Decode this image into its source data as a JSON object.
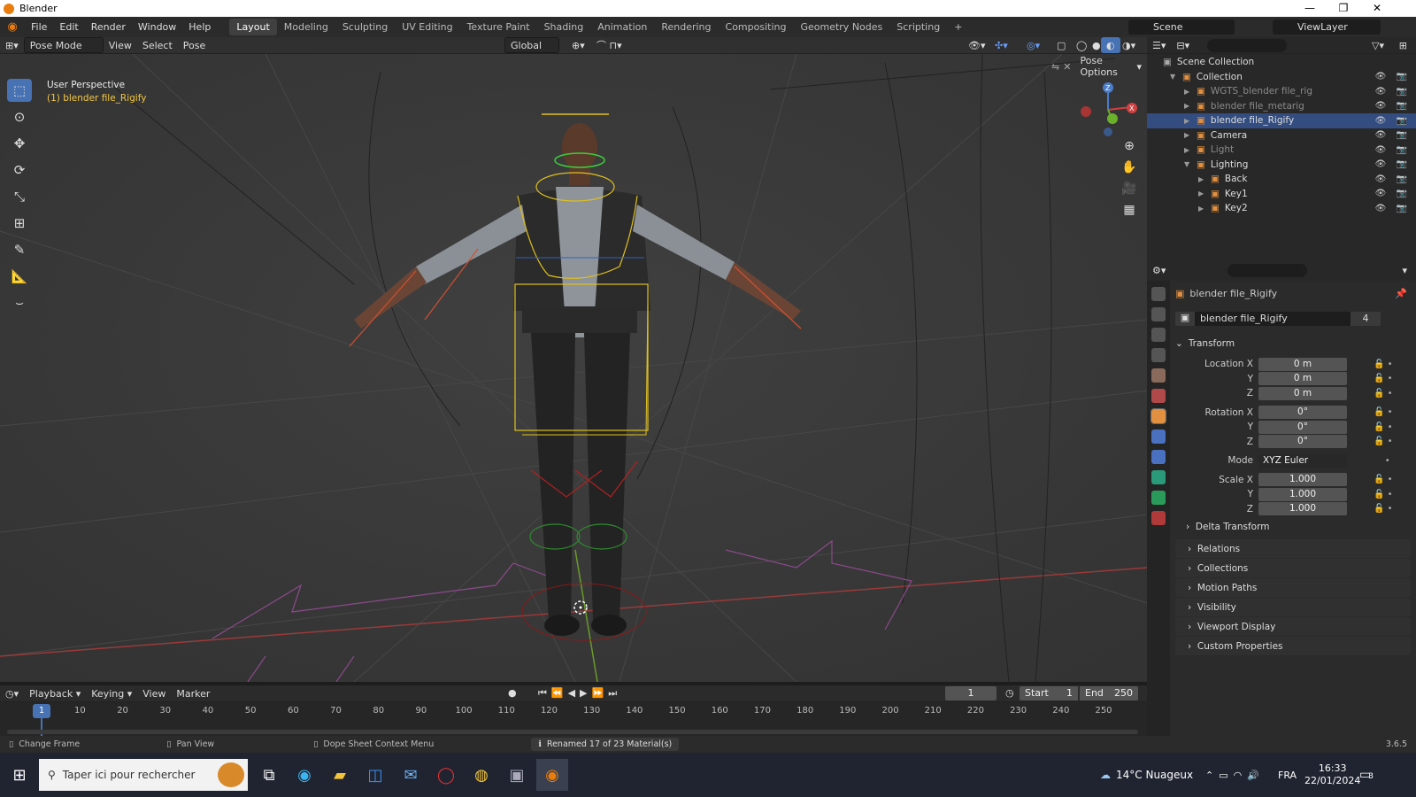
{
  "window": {
    "title": "Blender",
    "minimize": "—",
    "maximize": "❐",
    "close": "✕"
  },
  "menu": [
    "File",
    "Edit",
    "Render",
    "Window",
    "Help"
  ],
  "workspaces": [
    "Layout",
    "Modeling",
    "Sculpting",
    "UV Editing",
    "Texture Paint",
    "Shading",
    "Animation",
    "Rendering",
    "Compositing",
    "Geometry Nodes",
    "Scripting"
  ],
  "active_workspace": "Layout",
  "add_workspace": "+",
  "scene": {
    "label": "Scene",
    "viewlayer": "ViewLayer"
  },
  "viewport_header": {
    "mode": "Pose Mode",
    "menus": [
      "View",
      "Select",
      "Pose"
    ],
    "transform_orientation": "Global",
    "pose_options": "Pose Options"
  },
  "viewport": {
    "perspective": "User Perspective",
    "object_info": "(1) blender file_Rigify",
    "gizmo": {
      "x": "X",
      "y": "Y",
      "z": "Z"
    }
  },
  "outliner": {
    "root": "Scene Collection",
    "items": [
      {
        "label": "Collection",
        "indent": 1,
        "expanded": true,
        "selected": false,
        "dim": false
      },
      {
        "label": "WGTS_blender file_rig",
        "indent": 2,
        "expanded": false,
        "selected": false,
        "dim": true
      },
      {
        "label": "blender file_metarig",
        "indent": 2,
        "expanded": false,
        "selected": false,
        "dim": true
      },
      {
        "label": "blender file_Rigify",
        "indent": 2,
        "expanded": false,
        "selected": true,
        "dim": false
      },
      {
        "label": "Camera",
        "indent": 2,
        "expanded": false,
        "selected": false,
        "dim": false
      },
      {
        "label": "Light",
        "indent": 2,
        "expanded": false,
        "selected": false,
        "dim": true
      },
      {
        "label": "Lighting",
        "indent": 2,
        "expanded": true,
        "selected": false,
        "dim": false
      },
      {
        "label": "Back",
        "indent": 3,
        "expanded": false,
        "selected": false,
        "dim": false
      },
      {
        "label": "Key1",
        "indent": 3,
        "expanded": false,
        "selected": false,
        "dim": false
      },
      {
        "label": "Key2",
        "indent": 3,
        "expanded": false,
        "selected": false,
        "dim": false
      }
    ]
  },
  "properties": {
    "object_name": "blender file_Rigify",
    "data_name": "blender file_Rigify",
    "users": "4",
    "transform_title": "Transform",
    "location": {
      "label": "Location X",
      "x": "0 m",
      "y": "0 m",
      "z": "0 m"
    },
    "rotation": {
      "label": "Rotation X",
      "x": "0°",
      "y": "0°",
      "z": "0°"
    },
    "mode": {
      "label": "Mode",
      "value": "XYZ Euler"
    },
    "scale": {
      "label": "Scale X",
      "x": "1.000",
      "y": "1.000",
      "z": "1.000"
    },
    "axis_y": "Y",
    "axis_z": "Z",
    "delta_transform": "Delta Transform",
    "panels": [
      "Relations",
      "Collections",
      "Motion Paths",
      "Visibility",
      "Viewport Display",
      "Custom Properties"
    ]
  },
  "timeline": {
    "menus": [
      "Playback",
      "Keying",
      "View",
      "Marker"
    ],
    "current_frame": "1",
    "start_label": "Start",
    "start": "1",
    "end_label": "End",
    "end": "250",
    "ticks": [
      1,
      10,
      20,
      30,
      40,
      50,
      60,
      70,
      80,
      90,
      100,
      110,
      120,
      130,
      140,
      150,
      160,
      170,
      180,
      190,
      200,
      210,
      220,
      230,
      240,
      250
    ]
  },
  "statusbar": {
    "change_frame": "Change Frame",
    "pan_view": "Pan View",
    "context_menu": "Dope Sheet Context Menu",
    "message": "Renamed 17 of 23 Material(s)",
    "version": "3.6.5"
  },
  "taskbar": {
    "search_placeholder": "Taper ici pour rechercher",
    "weather": "14°C  Nuageux",
    "language": "FRA",
    "time": "16:33",
    "date": "22/01/2024",
    "notifications": "3"
  },
  "colors": {
    "accent": "#4772b3",
    "selected_row": "#334d80",
    "blender_orange": "#e87d0d"
  }
}
